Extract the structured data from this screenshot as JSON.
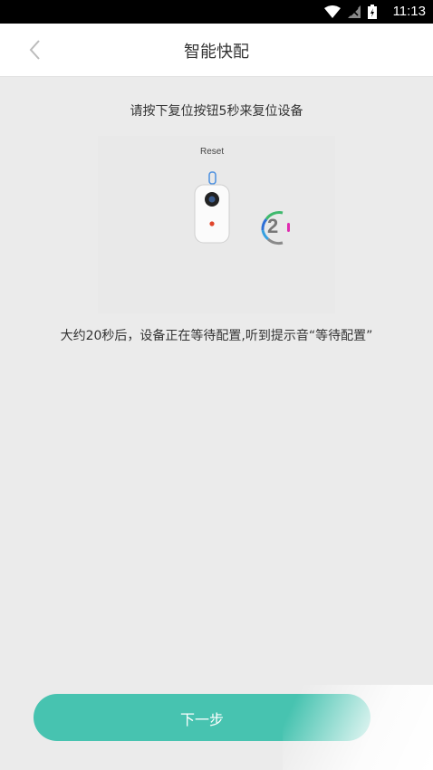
{
  "status_bar": {
    "time": "11:13",
    "icons": [
      "wifi-icon",
      "signal-icon",
      "battery-icon"
    ]
  },
  "header": {
    "back_icon": "chevron-left-icon",
    "title": "智能快配"
  },
  "instruction_top": "请按下复位按钮5秒来复位设备",
  "illustration": {
    "reset_label": "Reset",
    "countdown": "2"
  },
  "instruction_bottom": "大约20秒后，设备正在等待配置,听到提示音“等待配置”",
  "next_button": {
    "label": "下一步"
  },
  "colors": {
    "accent": "#47c3b0",
    "background": "#ebebeb"
  }
}
